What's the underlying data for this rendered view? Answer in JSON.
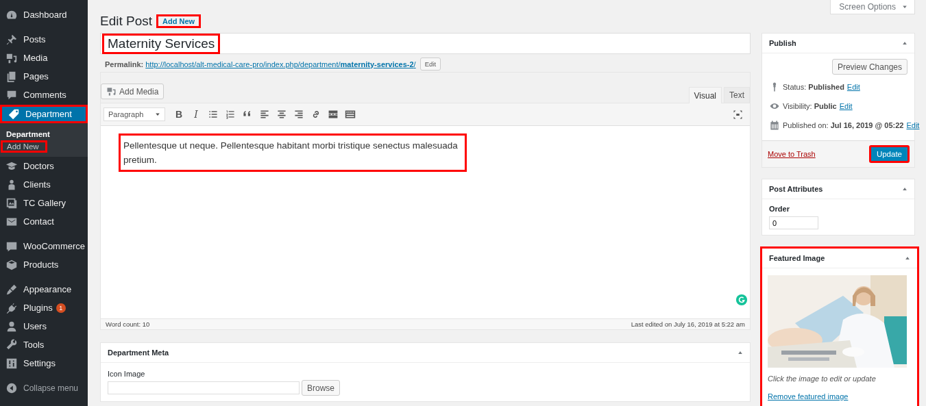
{
  "sidebar": {
    "groups": [
      {
        "items": [
          {
            "label": "Dashboard",
            "selected": false
          }
        ]
      },
      {
        "items": [
          {
            "label": "Posts",
            "selected": false
          },
          {
            "label": "Media",
            "selected": false
          },
          {
            "label": "Pages",
            "selected": false
          },
          {
            "label": "Comments",
            "selected": false
          },
          {
            "label": "Department",
            "selected": true,
            "highlighted": true,
            "children": [
              {
                "label": "Department",
                "selected": true,
                "highlighted": false
              },
              {
                "label": "Add New",
                "selected": false,
                "highlighted": true
              }
            ]
          },
          {
            "label": "Doctors",
            "selected": false
          },
          {
            "label": "Clients",
            "selected": false
          },
          {
            "label": "TC Gallery",
            "selected": false
          },
          {
            "label": "Contact",
            "selected": false
          }
        ]
      },
      {
        "items": [
          {
            "label": "WooCommerce",
            "selected": false
          },
          {
            "label": "Products",
            "selected": false
          }
        ]
      },
      {
        "items": [
          {
            "label": "Appearance",
            "selected": false
          },
          {
            "label": "Plugins",
            "selected": false,
            "badge": "1"
          },
          {
            "label": "Users",
            "selected": false
          },
          {
            "label": "Tools",
            "selected": false
          },
          {
            "label": "Settings",
            "selected": false
          }
        ]
      }
    ],
    "collapse": "Collapse menu"
  },
  "screen_options": "Screen Options",
  "heading": {
    "title": "Edit Post",
    "add_new": "Add New",
    "add_new_highlighted": true
  },
  "post_title": {
    "value": "Maternity Services",
    "highlighted": true
  },
  "permalink": {
    "label": "Permalink:",
    "url": "http://localhost/alt-medical-care-pro/index.php/department/",
    "slug": "maternity-services-2",
    "trail": "/",
    "edit": "Edit"
  },
  "editor": {
    "add_media": "Add Media",
    "tabs": [
      {
        "label": "Visual",
        "selected": true
      },
      {
        "label": "Text",
        "selected": false
      }
    ],
    "format": "Paragraph",
    "toolbar": [
      {
        "kind": "bold",
        "label": "B"
      },
      {
        "kind": "italic",
        "label": "I"
      },
      {
        "kind": "bullets"
      },
      {
        "kind": "numbers"
      },
      {
        "kind": "quote"
      },
      {
        "kind": "align-left"
      },
      {
        "kind": "align-center"
      },
      {
        "kind": "align-right"
      },
      {
        "kind": "link"
      },
      {
        "kind": "more"
      },
      {
        "kind": "toolbar-toggle"
      }
    ],
    "content": "Pellentesque ut neque. Pellentesque habitant morbi tristique senectus malesuada pretium.",
    "content_highlighted": true,
    "word_count": "Word count: 10",
    "last_edited": "Last edited on July 16, 2019 at 5:22 am"
  },
  "department_meta": {
    "title": "Department Meta",
    "field_label": "Icon Image",
    "button": "Browse"
  },
  "publish": {
    "title": "Publish",
    "preview": "Preview Changes",
    "rows": [
      {
        "label": "Status:",
        "value": "Published",
        "edit": "Edit"
      },
      {
        "label": "Visibility:",
        "value": "Public",
        "edit": "Edit"
      },
      {
        "label": "Published on:",
        "value": "Jul 16, 2019 @ 05:22",
        "edit": "Edit"
      }
    ],
    "trash": "Move to Trash",
    "update": "Update",
    "update_highlighted": true
  },
  "post_attributes": {
    "title": "Post Attributes",
    "order_label": "Order",
    "order_value": "0"
  },
  "featured_image": {
    "title": "Featured Image",
    "highlighted": true,
    "hint": "Click the image to edit or update",
    "remove": "Remove featured image"
  }
}
